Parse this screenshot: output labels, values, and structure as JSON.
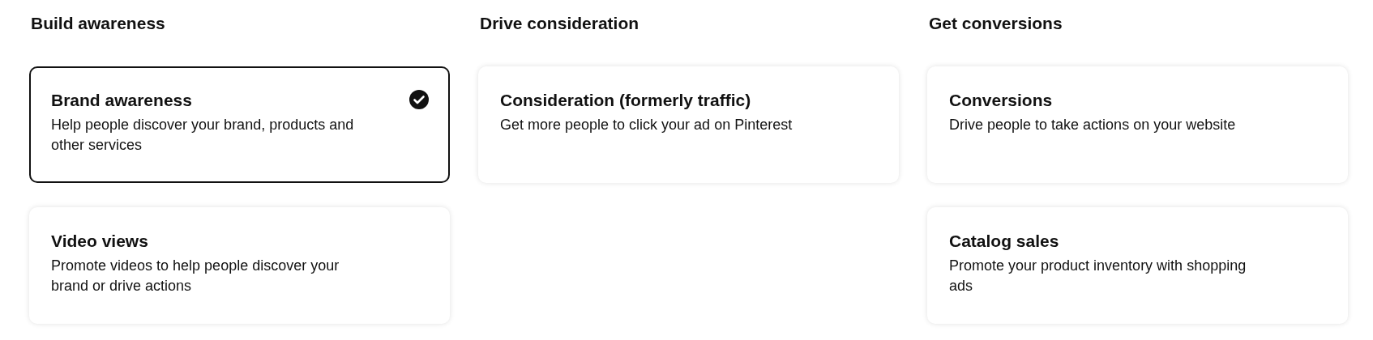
{
  "columns": [
    {
      "heading": "Build awareness",
      "cards": [
        {
          "title": "Brand awareness",
          "description": "Help people discover your brand, products and other services",
          "selected": true
        },
        {
          "title": "Video views",
          "description": "Promote videos to help people discover your brand or drive actions",
          "selected": false
        }
      ]
    },
    {
      "heading": "Drive consideration",
      "cards": [
        {
          "title": "Consideration (formerly traffic)",
          "description": "Get more people to click your ad on Pinterest",
          "selected": false
        }
      ]
    },
    {
      "heading": "Get conversions",
      "cards": [
        {
          "title": "Conversions",
          "description": "Drive people to take actions on your website",
          "selected": false
        },
        {
          "title": "Catalog sales",
          "description": "Promote your product inventory with shopping ads",
          "selected": false
        }
      ]
    }
  ]
}
